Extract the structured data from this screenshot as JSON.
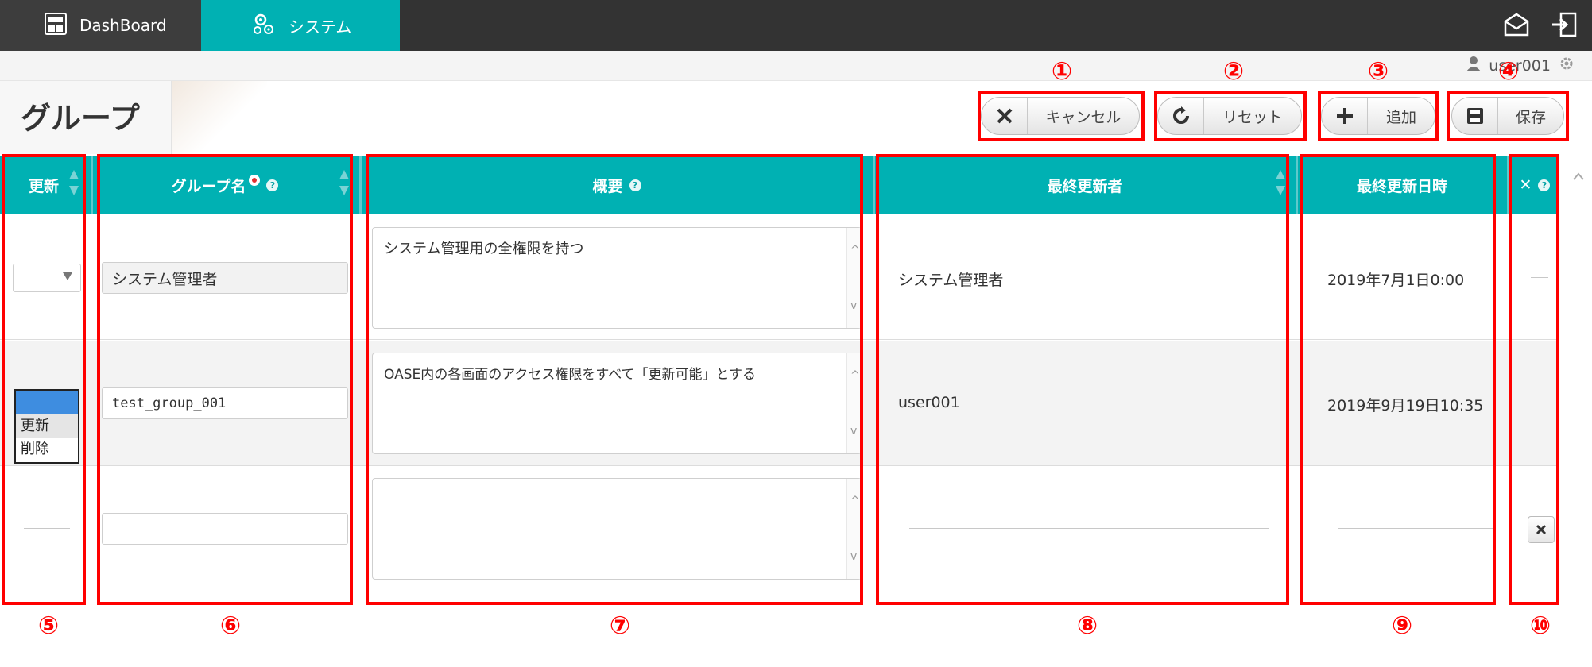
{
  "topnav": {
    "dashboard_label": "DashBoard",
    "system_label": "システム",
    "active_color": "#00b1b3"
  },
  "user": {
    "name": "user001"
  },
  "page": {
    "title": "グループ"
  },
  "toolbar": {
    "cancel_label": "キャンセル",
    "reset_label": "リセット",
    "add_label": "追加",
    "save_label": "保存"
  },
  "annotations": [
    "①",
    "②",
    "③",
    "④",
    "⑤",
    "⑥",
    "⑦",
    "⑧",
    "⑨",
    "⑩"
  ],
  "table": {
    "headers": {
      "update": "更新",
      "group_name": "グループ名",
      "summary": "概要",
      "last_updated_by": "最終更新者",
      "last_updated_at": "最終更新日時",
      "delete": "✕"
    },
    "rows": [
      {
        "group_name": "システム管理者",
        "summary": "システム管理用の全権限を持つ",
        "last_updated_by": "システム管理者",
        "last_updated_at": "2019年7月1日0:00"
      },
      {
        "group_name": "test_group_001",
        "summary": "OASE内の各画面のアクセス権限をすべて「更新可能」とする",
        "last_updated_by": "user001",
        "last_updated_at": "2019年9月19日10:35"
      },
      {
        "group_name": "",
        "summary": "",
        "last_updated_by": "",
        "last_updated_at": ""
      }
    ],
    "update_options": [
      "",
      "更新",
      "削除"
    ]
  }
}
